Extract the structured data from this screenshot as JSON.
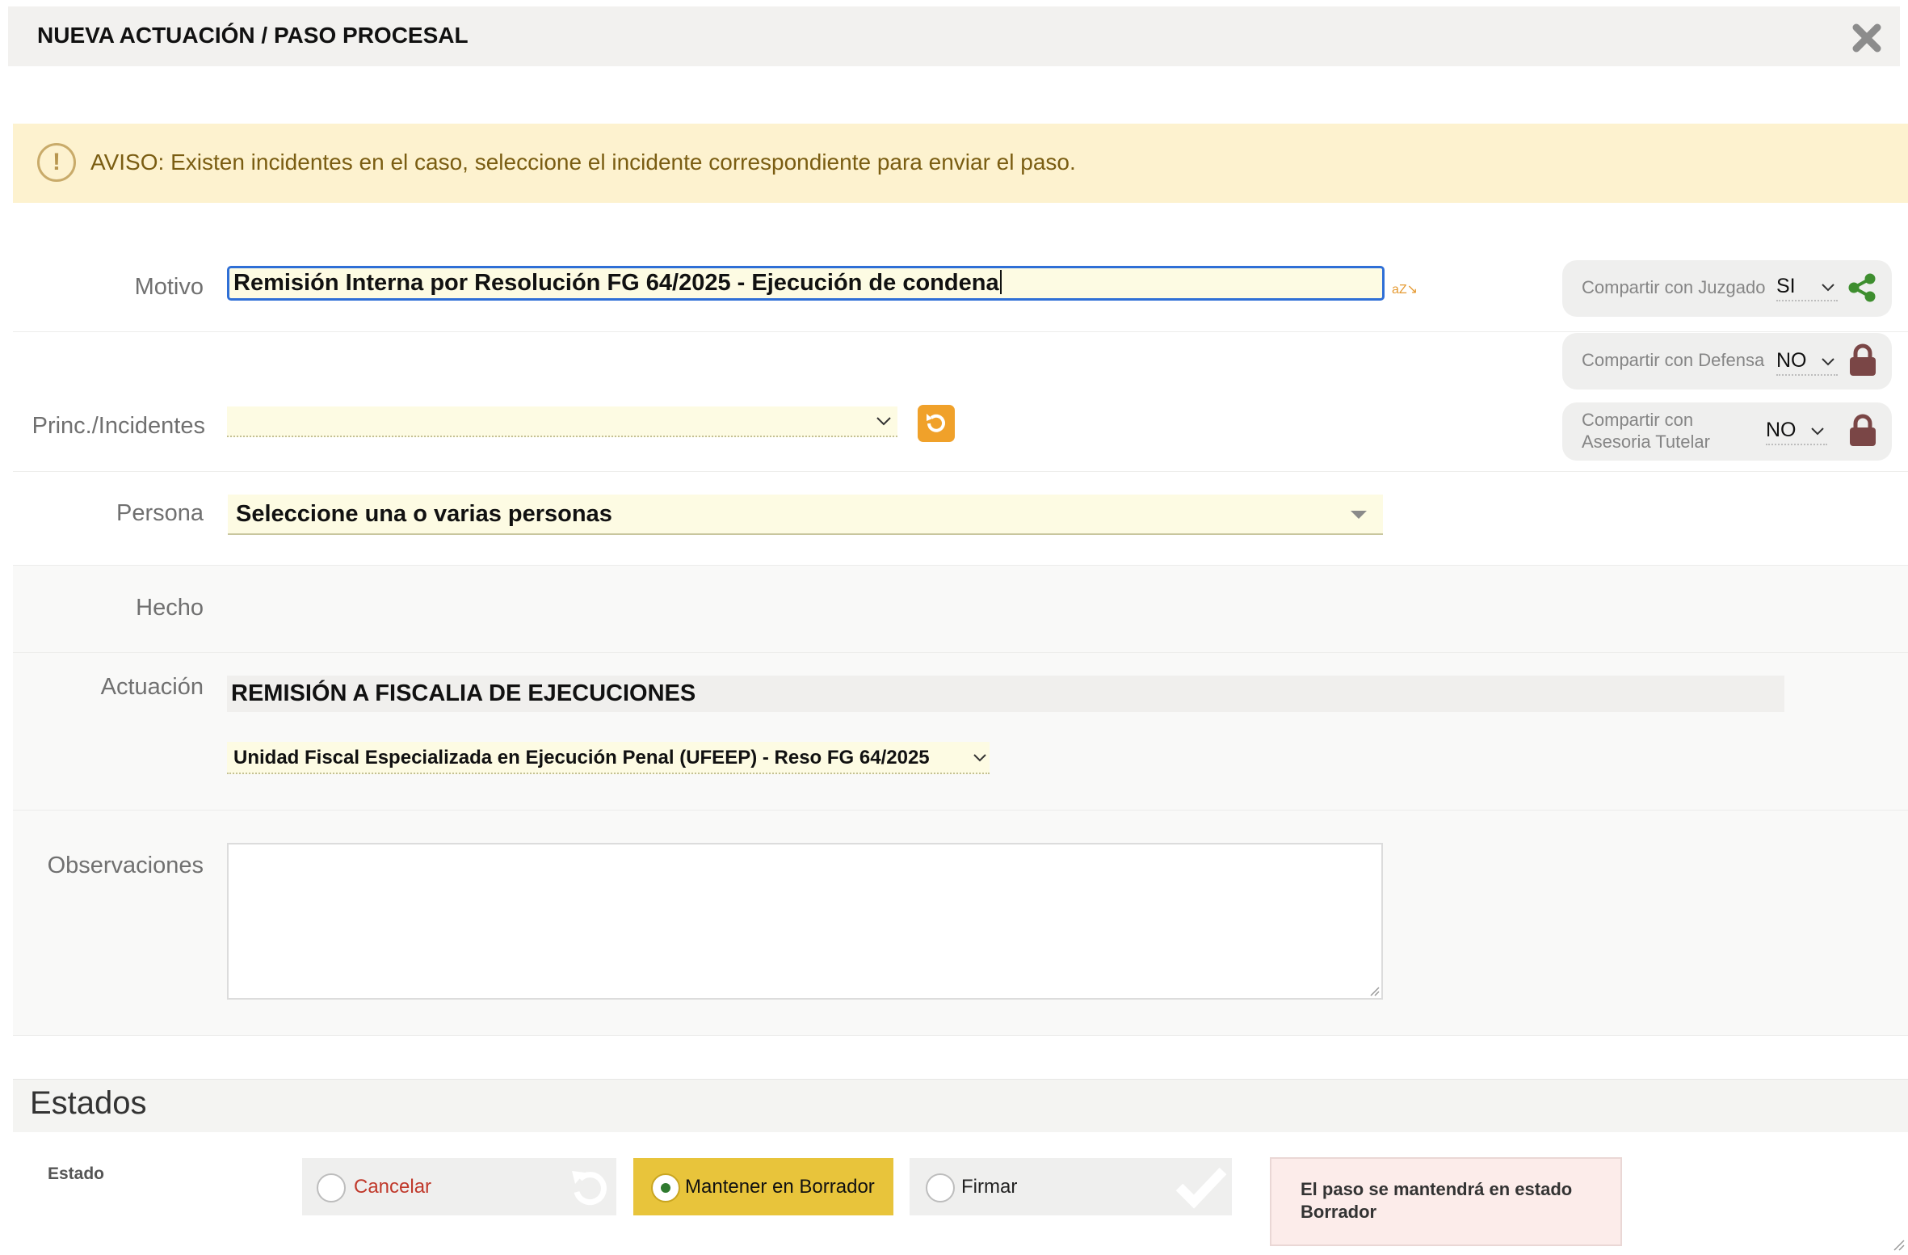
{
  "header": {
    "title": "NUEVA ACTUACIÓN / PASO PROCESAL",
    "close_icon": "close-x-icon"
  },
  "warning": {
    "icon": "exclamation-circle-icon",
    "text": "AVISO: Existen incidentes en el caso, seleccione el incidente correspondiente para enviar el paso."
  },
  "form": {
    "motivo": {
      "label": "Motivo",
      "value": "Remisión Interna por Resolución FG 64/2025 - Ejecución de condena",
      "az": "aZ"
    },
    "incidentes": {
      "label": "Princ./Incidentes",
      "value": ""
    },
    "persona": {
      "label": "Persona",
      "placeholder": "Seleccione una o varias personas"
    },
    "hecho": {
      "label": "Hecho"
    },
    "actuacion": {
      "label": "Actuación",
      "value": "REMISIÓN A FISCALIA DE EJECUCIONES",
      "unidad": "Unidad Fiscal Especializada en Ejecución Penal (UFEEP) - Reso FG 64/2025"
    },
    "observaciones": {
      "label": "Observaciones",
      "value": ""
    }
  },
  "sharing": [
    {
      "label": "Compartir con Juzgado",
      "value": "SI",
      "icon": "share-icon"
    },
    {
      "label": "Compartir con Defensa",
      "value": "NO",
      "icon": "lock-icon"
    },
    {
      "label_line1": "Compartir con",
      "label_line2": "Asesoria Tutelar",
      "value": "NO",
      "icon": "lock-icon"
    }
  ],
  "estados": {
    "title": "Estados",
    "label": "Estado",
    "options": [
      {
        "label": "Cancelar",
        "selected": false,
        "icon": "undo-icon",
        "color": "#c0392b"
      },
      {
        "label": "Mantener en Borrador",
        "selected": true,
        "color": "#e8c43b"
      },
      {
        "label": "Firmar",
        "selected": false,
        "icon": "checkmark-icon"
      }
    ],
    "info_line1": "El paso se mantendrá en estado",
    "info_line2": "Borrador"
  },
  "colors": {
    "accent_yellow": "#e8c43b",
    "warning_bg": "#fdf2cf",
    "refresh_orange": "#f0a12a",
    "share_green": "#3e8e2f",
    "lock_brown": "#7a4646"
  }
}
